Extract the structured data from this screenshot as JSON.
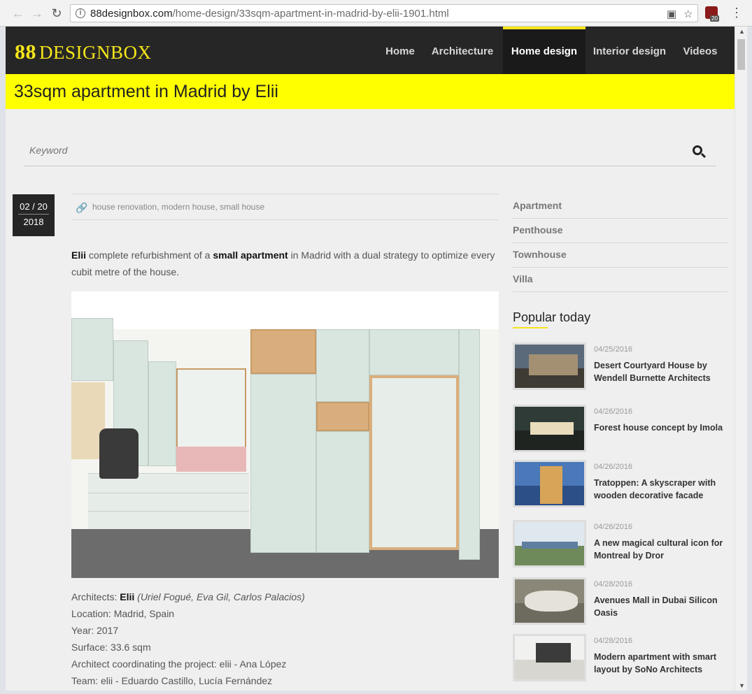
{
  "browser": {
    "url_host": "88designbox.com",
    "url_path": "/home-design/33sqm-apartment-in-madrid-by-elii-1901.html",
    "ext_badge": "20"
  },
  "site": {
    "logo_mark": "88",
    "logo_text": "DESIGNBOX",
    "nav": [
      {
        "label": "Home"
      },
      {
        "label": "Architecture"
      },
      {
        "label": "Home design"
      },
      {
        "label": "Interior design"
      },
      {
        "label": "Videos"
      }
    ],
    "active_nav": "Home design",
    "accent": "#f5e51a"
  },
  "article": {
    "title": "33sqm apartment in Madrid by Elii",
    "date_md": "02 / 20",
    "date_year": "2018",
    "tags": "house renovation, modern house, small house",
    "intro_1": "Elii",
    "intro_2": " complete refurbishment of a ",
    "intro_3": "small apartment",
    "intro_4": " in Madrid with a dual strategy to optimize every cubit metre of the house.",
    "details": {
      "architects_label": "Architects: ",
      "architects_name": "Elii",
      "architects_team": " (Uriel Fogué, Eva Gil, Carlos Palacios)",
      "location": "Location: Madrid, Spain",
      "year": "Year: 2017",
      "surface": "Surface: 33.6 sqm",
      "coordinating": "Architect coordinating the project: elii - Ana López",
      "team": "Team: elii - Eduardo Castillo, Lucía Fernández"
    }
  },
  "search": {
    "placeholder": "Keyword"
  },
  "sidebar": {
    "categories": [
      {
        "label": "Apartment"
      },
      {
        "label": "Penthouse"
      },
      {
        "label": "Townhouse"
      },
      {
        "label": "Villa"
      }
    ],
    "popular_title": "Popular today",
    "popular": [
      {
        "date": "04/25/2016",
        "title": "Desert Courtyard House by Wendell Burnette Architects"
      },
      {
        "date": "04/26/2016",
        "title": "Forest house concept by Imola"
      },
      {
        "date": "04/26/2016",
        "title": "Tratoppen: A skyscraper with wooden decorative facade"
      },
      {
        "date": "04/26/2016",
        "title": "A new magical cultural icon for Montreal by Dror"
      },
      {
        "date": "04/28/2016",
        "title": "Avenues Mall in Dubai Silicon Oasis"
      },
      {
        "date": "04/28/2016",
        "title": "Modern apartment with smart layout by SoNo Architects"
      }
    ]
  }
}
